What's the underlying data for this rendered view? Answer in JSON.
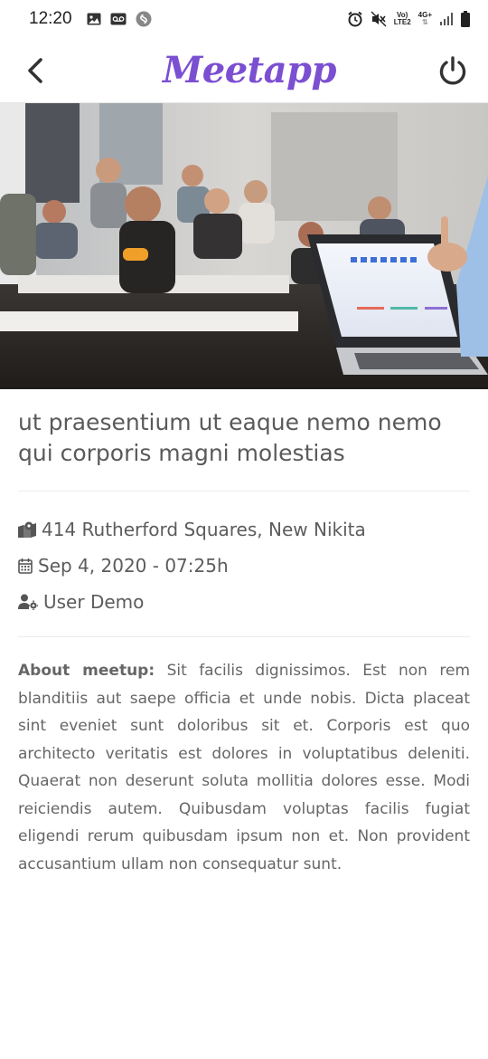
{
  "status_bar": {
    "time": "12:20",
    "network_top": "Vo)",
    "network_bottom": "LTE2",
    "network_gen": "4G+"
  },
  "header": {
    "brand": "Meetapp"
  },
  "event": {
    "title": "ut praesentium ut eaque nemo nemo qui corporis magni molestias",
    "address": "414 Rutherford Squares, New Nikita",
    "datetime": "Sep 4, 2020 - 07:25h",
    "organizer": "User Demo",
    "about_label": "About meetup:",
    "about_text": " Sit facilis dignissimos. Est non rem blanditiis aut saepe officia et unde nobis. Dicta placeat sint eveniet sunt doloribus sit et. Corporis est quo architecto veritatis est dolores in voluptatibus deleniti.   Quaerat non deserunt soluta mollitia dolores esse. Modi reiciendis autem. Quibusdam voluptas facilis fugiat eligendi rerum quibusdam ipsum non et. Non provident accusantium ullam non consequatur sunt."
  },
  "colors": {
    "brand": "#7b4fd1",
    "text": "#5a5a5a"
  },
  "icons": [
    "image-icon",
    "voicemail-icon",
    "shazam-icon",
    "alarm-icon",
    "mute-icon",
    "signal-icon",
    "battery-icon",
    "back-arrow-icon",
    "power-icon",
    "map-marker-icon",
    "calendar-icon",
    "user-cog-icon"
  ]
}
